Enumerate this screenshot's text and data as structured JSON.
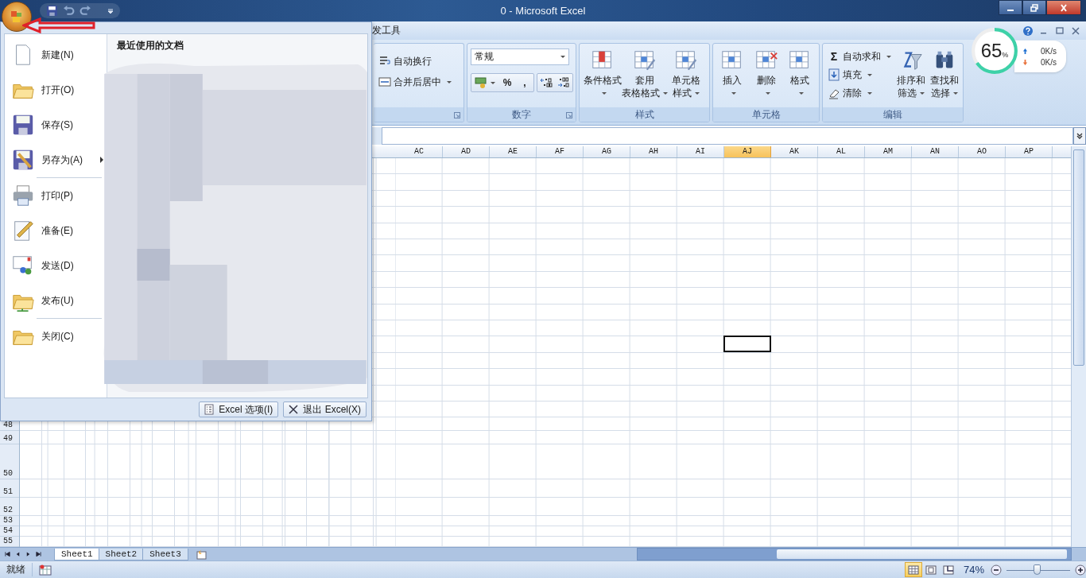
{
  "window": {
    "title": "0 - Microsoft Excel"
  },
  "ribbon_tabs": [
    {
      "label": "发工具",
      "selected": false
    }
  ],
  "ribbon_groups": [
    {
      "kind": "alignment",
      "small_buttons": [
        {
          "label": "自动换行",
          "dropdown": false
        },
        {
          "label": "合并后居中",
          "dropdown": true
        }
      ]
    },
    {
      "kind": "number",
      "label": "数字",
      "format_field": {
        "value": "常规"
      },
      "buttons": [
        "%",
        ","
      ]
    },
    {
      "kind": "large",
      "label": "样式",
      "large_buttons": [
        {
          "lines": [
            "条件格式"
          ],
          "dropdown": true
        },
        {
          "lines": [
            "套用",
            "表格格式"
          ],
          "dropdown": true
        },
        {
          "lines": [
            "单元格",
            "样式"
          ],
          "dropdown": true
        }
      ]
    },
    {
      "kind": "large",
      "label": "单元格",
      "large_buttons": [
        {
          "lines": [
            "插入"
          ],
          "dropdown": true
        },
        {
          "lines": [
            "删除"
          ],
          "dropdown": true
        },
        {
          "lines": [
            "格式"
          ],
          "dropdown": true
        }
      ]
    },
    {
      "kind": "editing",
      "label": "编辑",
      "small_buttons": [
        {
          "glyph": "Σ",
          "label": "自动求和",
          "dropdown": true
        },
        {
          "label": "填充",
          "dropdown": true
        },
        {
          "label": "清除",
          "dropdown": true
        }
      ],
      "large_buttons": [
        {
          "lines": [
            "排序和",
            "筛选"
          ],
          "dropdown": true
        },
        {
          "lines": [
            "查找和",
            "选择"
          ],
          "dropdown": true
        }
      ]
    }
  ],
  "speed_widget": {
    "percent": "65",
    "unit": "%",
    "level": 0.65,
    "upload": "0K/s",
    "download": "0K/s"
  },
  "columns": [
    {
      "label": "AC",
      "selected": false
    },
    {
      "label": "AD",
      "selected": false
    },
    {
      "label": "AE",
      "selected": false
    },
    {
      "label": "AF",
      "selected": false
    },
    {
      "label": "AG",
      "selected": false
    },
    {
      "label": "AH",
      "selected": false
    },
    {
      "label": "AI",
      "selected": false
    },
    {
      "label": "AJ",
      "selected": true
    },
    {
      "label": "AK",
      "selected": false
    },
    {
      "label": "AL",
      "selected": false
    },
    {
      "label": "AM",
      "selected": false
    },
    {
      "label": "AN",
      "selected": false
    },
    {
      "label": "AO",
      "selected": false
    },
    {
      "label": "AP",
      "selected": false
    }
  ],
  "rows": [
    {
      "label": "48",
      "kind": "normal"
    },
    {
      "label": "49",
      "kind": "normal"
    },
    {
      "label": "50",
      "kind": "tall"
    },
    {
      "label": "51",
      "kind": "medium"
    },
    {
      "label": "52",
      "kind": "medium"
    },
    {
      "label": "53",
      "kind": "short"
    },
    {
      "label": "54",
      "kind": "short"
    },
    {
      "label": "55",
      "kind": "short"
    }
  ],
  "sheet_tabs": [
    {
      "label": "Sheet1",
      "selected": true
    },
    {
      "label": "Sheet2",
      "selected": false
    },
    {
      "label": "Sheet3",
      "selected": false
    }
  ],
  "status_bar": {
    "status": "就绪",
    "view_buttons": [
      {
        "selected": true
      },
      {
        "selected": false
      },
      {
        "selected": false
      }
    ],
    "zoom": "74%",
    "zoom_slider": {
      "level": 0.47
    }
  },
  "office_menu": {
    "items": [
      {
        "label": "新建(N)",
        "submenu": false,
        "separator_after": false
      },
      {
        "label": "打开(O)",
        "submenu": false,
        "separator_after": false
      },
      {
        "label": "保存(S)",
        "submenu": false,
        "separator_after": false
      },
      {
        "label": "另存为(A)",
        "submenu": true,
        "separator_after": true
      },
      {
        "label": "打印(P)",
        "submenu": false,
        "separator_after": false
      },
      {
        "label": "准备(E)",
        "submenu": false,
        "separator_after": false
      },
      {
        "label": "发送(D)",
        "submenu": false,
        "separator_after": false
      },
      {
        "label": "发布(U)",
        "submenu": false,
        "separator_after": true
      },
      {
        "label": "关闭(C)",
        "submenu": false,
        "separator_after": false
      }
    ],
    "recent_heading": "最近使用的文档",
    "buttons": [
      "Excel 选项(I)",
      "退出 Excel(X)"
    ]
  }
}
